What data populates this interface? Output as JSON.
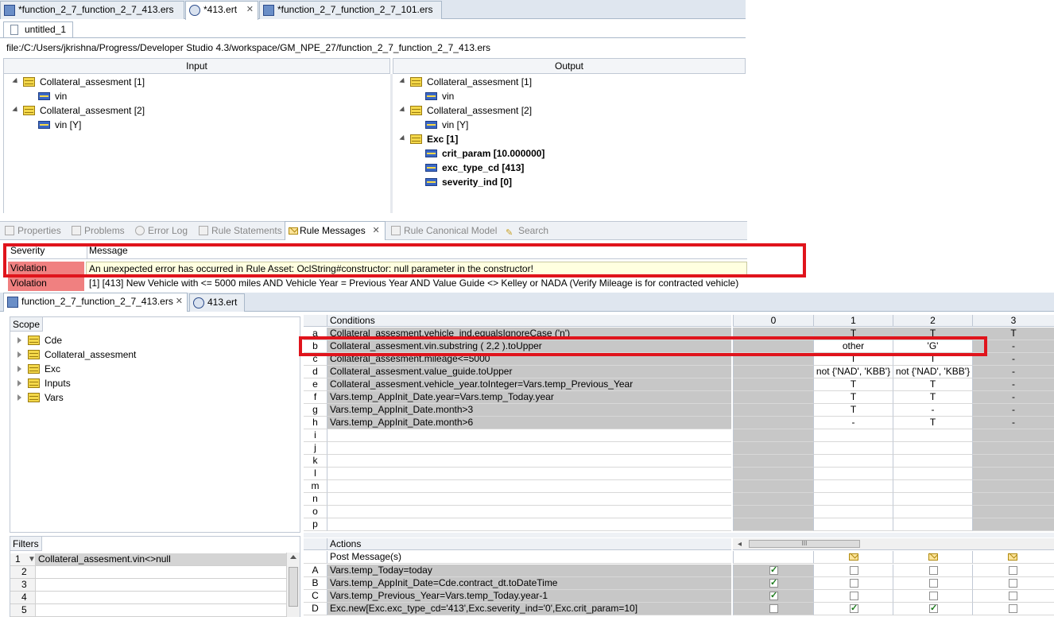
{
  "top_tabs": [
    {
      "label": "*function_2_7_function_2_7_413.ers"
    },
    {
      "label": "*413.ert"
    },
    {
      "label": "*function_2_7_function_2_7_101.ers"
    }
  ],
  "sub_tab": {
    "label": "untitled_1"
  },
  "file_path": "file:/C:/Users/jkrishna/Progress/Developer Studio 4.3/workspace/GM_NPE_27/function_2_7_function_2_7_413.ers",
  "input_panel": {
    "header": "Input",
    "items": [
      {
        "label": "Collateral_assesment [1]"
      },
      {
        "label": "vin"
      },
      {
        "label": "Collateral_assesment [2]"
      },
      {
        "label": "vin [Y]"
      }
    ]
  },
  "output_panel": {
    "header": "Output",
    "items": [
      {
        "label": "Collateral_assesment [1]"
      },
      {
        "label": "vin"
      },
      {
        "label": "Collateral_assesment [2]"
      },
      {
        "label": "vin [Y]"
      },
      {
        "label": "Exc [1]"
      },
      {
        "label": "crit_param [10.000000]"
      },
      {
        "label": "exc_type_cd [413]"
      },
      {
        "label": "severity_ind [0]"
      }
    ]
  },
  "views": [
    "Properties",
    "Problems",
    "Error Log",
    "Rule Statements",
    "Rule Messages",
    "Rule Canonical Model",
    "Search"
  ],
  "messages": {
    "severity_header": "Severity",
    "message_header": "Message",
    "rows": [
      {
        "severity": "Violation",
        "message": "An unexpected error has occurred in Rule Asset: OclString#constructor: null parameter in the constructor!"
      },
      {
        "severity": "Violation",
        "message": "[1] [413] New Vehicle with <= 5000 miles AND Vehicle Year = Previous Year AND Value Guide <> Kelley or NADA (Verify Mileage is for contracted vehicle)"
      }
    ]
  },
  "editor_tabs": [
    {
      "label": "function_2_7_function_2_7_413.ers"
    },
    {
      "label": "413.ert"
    }
  ],
  "scope": {
    "header": "Scope",
    "items": [
      "Cde",
      "Collateral_assesment",
      "Exc",
      "Inputs",
      "Vars"
    ]
  },
  "filters": {
    "header": "Filters",
    "rows": [
      {
        "num": "1",
        "text": "Collateral_assesment.vin<>null"
      },
      {
        "num": "2",
        "text": ""
      },
      {
        "num": "3",
        "text": ""
      },
      {
        "num": "4",
        "text": ""
      },
      {
        "num": "5",
        "text": ""
      }
    ]
  },
  "conditions": {
    "header": "Conditions",
    "col_headers": [
      "0",
      "1",
      "2",
      "3"
    ],
    "rows": [
      {
        "id": "a",
        "expr": "Collateral_assesment.vehicle_ind.equalsIgnoreCase ('n')",
        "c0": "",
        "c1": "T",
        "c2": "T",
        "c3": "T"
      },
      {
        "id": "b",
        "expr": "Collateral_assesment.vin.substring ( 2,2 ).toUpper",
        "c0": "",
        "c1": "other",
        "c2": "'G'",
        "c3": "-"
      },
      {
        "id": "c",
        "expr": "Collateral_assesment.mileage<=5000",
        "c0": "",
        "c1": "T",
        "c2": "T",
        "c3": "-"
      },
      {
        "id": "d",
        "expr": "Collateral_assesment.value_guide.toUpper",
        "c0": "",
        "c1": "not {'NAD', 'KBB'}",
        "c2": "not {'NAD', 'KBB'}",
        "c3": "-"
      },
      {
        "id": "e",
        "expr": "Collateral_assesment.vehicle_year.toInteger=Vars.temp_Previous_Year",
        "c0": "",
        "c1": "T",
        "c2": "T",
        "c3": "-"
      },
      {
        "id": "f",
        "expr": "Vars.temp_AppInit_Date.year=Vars.temp_Today.year",
        "c0": "",
        "c1": "T",
        "c2": "T",
        "c3": "-"
      },
      {
        "id": "g",
        "expr": "Vars.temp_AppInit_Date.month>3",
        "c0": "",
        "c1": "T",
        "c2": "-",
        "c3": "-"
      },
      {
        "id": "h",
        "expr": "Vars.temp_AppInit_Date.month>6",
        "c0": "",
        "c1": "-",
        "c2": "T",
        "c3": "-"
      },
      {
        "id": "i",
        "expr": "",
        "c0": "",
        "c1": "",
        "c2": "",
        "c3": ""
      },
      {
        "id": "j",
        "expr": "",
        "c0": "",
        "c1": "",
        "c2": "",
        "c3": ""
      },
      {
        "id": "k",
        "expr": "",
        "c0": "",
        "c1": "",
        "c2": "",
        "c3": ""
      },
      {
        "id": "l",
        "expr": "",
        "c0": "",
        "c1": "",
        "c2": "",
        "c3": ""
      },
      {
        "id": "m",
        "expr": "",
        "c0": "",
        "c1": "",
        "c2": "",
        "c3": ""
      },
      {
        "id": "n",
        "expr": "",
        "c0": "",
        "c1": "",
        "c2": "",
        "c3": ""
      },
      {
        "id": "o",
        "expr": "",
        "c0": "",
        "c1": "",
        "c2": "",
        "c3": ""
      },
      {
        "id": "p",
        "expr": "",
        "c0": "",
        "c1": "",
        "c2": "",
        "c3": ""
      }
    ]
  },
  "actions": {
    "header": "Actions",
    "post_message": "Post Message(s)",
    "scroll_label": "III",
    "rows": [
      {
        "id": "A",
        "expr": "Vars.temp_Today=today",
        "checks": [
          true,
          false,
          false,
          false
        ]
      },
      {
        "id": "B",
        "expr": "Vars.temp_AppInit_Date=Cde.contract_dt.toDateTime",
        "checks": [
          true,
          false,
          false,
          false
        ]
      },
      {
        "id": "C",
        "expr": "Vars.temp_Previous_Year=Vars.temp_Today.year-1",
        "checks": [
          true,
          false,
          false,
          false
        ]
      },
      {
        "id": "D",
        "expr": "Exc.new[Exc.exc_type_cd='413',Exc.severity_ind='0',Exc.crit_param=10]",
        "checks": [
          false,
          true,
          true,
          false
        ]
      }
    ]
  }
}
